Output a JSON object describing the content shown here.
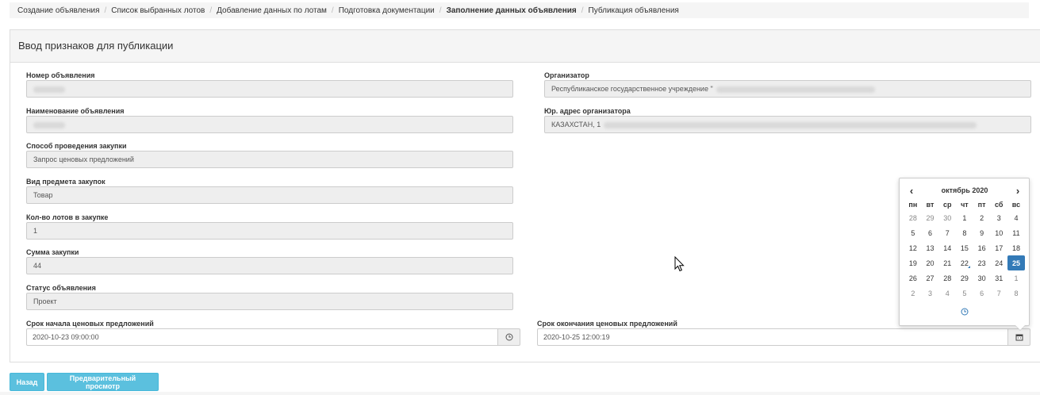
{
  "breadcrumb": {
    "items": [
      {
        "label": "Создание объявления"
      },
      {
        "label": "Список выбранных лотов"
      },
      {
        "label": "Добавление данных по лотам"
      },
      {
        "label": "Подготовка документации"
      },
      {
        "label": "Заполнение данных объявления"
      },
      {
        "label": "Публикация объявления"
      }
    ]
  },
  "panel": {
    "title": "Ввод признаков для публикации"
  },
  "form": {
    "announcement_number": {
      "label": "Номер объявления",
      "value": ""
    },
    "announcement_name": {
      "label": "Наименование объявления",
      "value": ""
    },
    "procurement_method": {
      "label": "Способ проведения закупки",
      "value": "Запрос ценовых предложений"
    },
    "subject_type": {
      "label": "Вид предмета закупок",
      "value": "Товар"
    },
    "lots_count": {
      "label": "Кол-во лотов в закупке",
      "value": "1"
    },
    "amount": {
      "label": "Сумма закупки",
      "value": "44"
    },
    "status": {
      "label": "Статус объявления",
      "value": "Проект"
    },
    "organizer": {
      "label": "Организатор",
      "value": "Республиканское государственное учреждение \""
    },
    "organizer_address": {
      "label": "Юр. адрес организатора",
      "value": "КАЗАХСТАН, 1"
    },
    "start_date": {
      "label": "Срок начала ценовых предложений",
      "value": "2020-10-23 09:00:00"
    },
    "end_date": {
      "label": "Срок окончания ценовых предложений",
      "value": "2020-10-25 12:00:19"
    }
  },
  "buttons": {
    "back": "Назад",
    "preview": "Предварительный просмотр"
  },
  "datepicker": {
    "month_label": "октябрь 2020",
    "prev": "‹",
    "next": "›",
    "weekdays": [
      "пн",
      "вт",
      "ср",
      "чт",
      "пт",
      "сб",
      "вс"
    ],
    "weeks": [
      [
        "28",
        "29",
        "30",
        "1",
        "2",
        "3",
        "4"
      ],
      [
        "5",
        "6",
        "7",
        "8",
        "9",
        "10",
        "11"
      ],
      [
        "12",
        "13",
        "14",
        "15",
        "16",
        "17",
        "18"
      ],
      [
        "19",
        "20",
        "21",
        "22",
        "23",
        "24",
        "25"
      ],
      [
        "26",
        "27",
        "28",
        "29",
        "30",
        "31",
        "1"
      ],
      [
        "2",
        "3",
        "4",
        "5",
        "6",
        "7",
        "8"
      ]
    ],
    "selected_day": "25",
    "today_day": "22"
  },
  "colors": {
    "primary": "#337ab7",
    "info_button": "#5bc0de",
    "readonly_bg": "#eeeeee"
  }
}
